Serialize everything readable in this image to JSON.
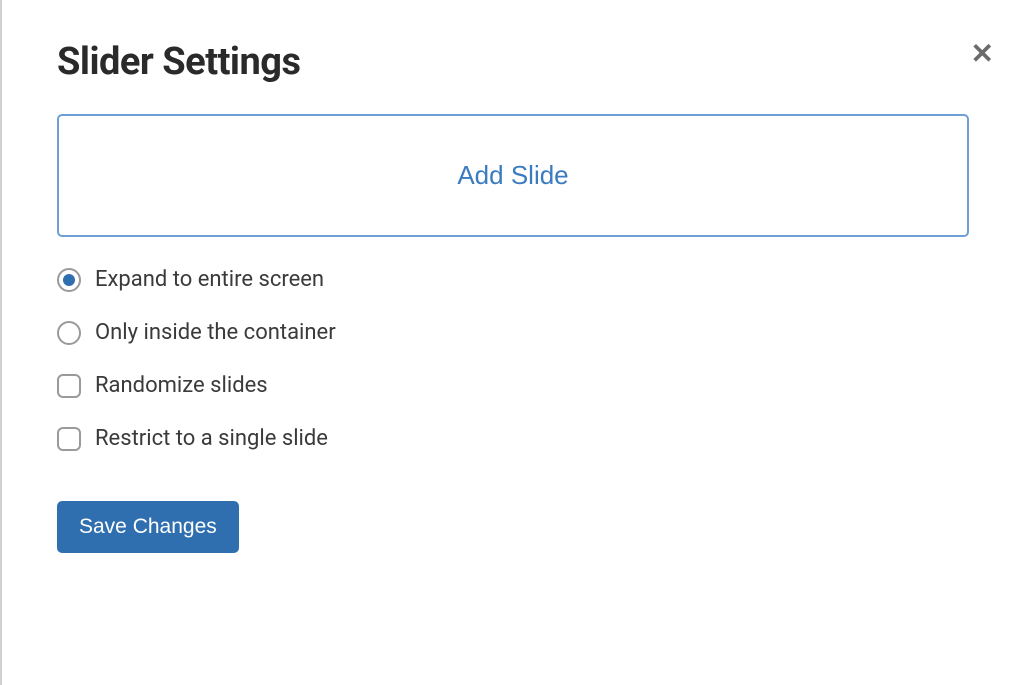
{
  "modal": {
    "title": "Slider Settings",
    "add_slide_label": "Add Slide",
    "save_button_label": "Save Changes"
  },
  "options": {
    "radio_expand": {
      "label": "Expand to entire screen",
      "selected": true
    },
    "radio_container": {
      "label": "Only inside the container",
      "selected": false
    },
    "checkbox_randomize": {
      "label": "Randomize slides",
      "checked": false
    },
    "checkbox_restrict": {
      "label": "Restrict to a single slide",
      "checked": false
    }
  }
}
